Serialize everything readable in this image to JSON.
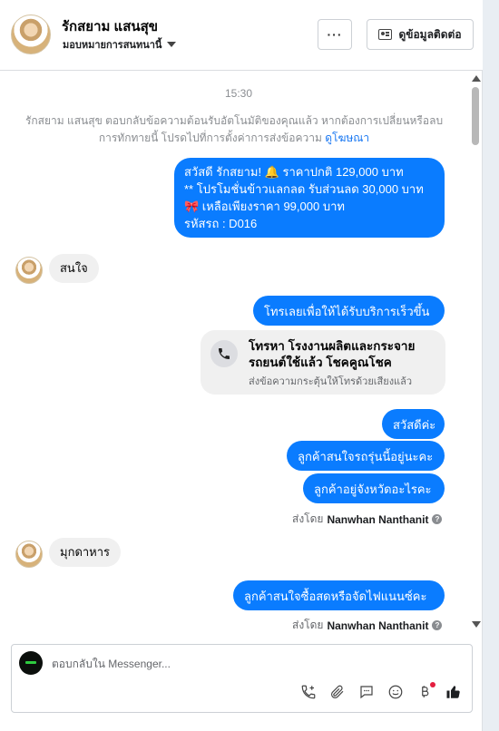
{
  "header": {
    "contact_name": "รักสยาม แสนสุข",
    "assign_label": "มอบหมายการสนทนานี้",
    "more_label": "···",
    "view_contact_label": "ดูข้อมูลติดต่อ"
  },
  "chat": {
    "timestamp": "15:30",
    "system_message": "รักสยาม แสนสุข ตอบกลับข้อความต้อนรับอัตโนมัติของคุณแล้ว หากต้องการเปลี่ยนหรือลบการทักทายนี้ โปรดไปที่การตั้งค่าการส่งข้อความ",
    "system_link": "ดูโฆษณา",
    "promo_lines": [
      "สวัสดี รักสยาม! 🔔 ราคาปกติ 129,000 บาท",
      "** โปรโมชั่นข้าวแลกลด รับส่วนลด 30,000 บาท",
      "🎀  เหลือเพียงราคา 99,000 บาท",
      " รหัสรถ : D016"
    ],
    "customer_msg_1": "สนใจ",
    "out_call_prompt": "โทรเลยเพื่อให้ได้รับบริการเร็วขึ้น",
    "call_card": {
      "title": "โทรหา โรงงานผลิตและกระจายรถยนต์ใช้แล้ว โชคคูณโชค",
      "subtitle": "ส่งข้อความกระตุ้นให้โทรด้วยเสียงแล้ว",
      "icon": "phone-icon"
    },
    "out_hello": "สวัสดีค่ะ",
    "out_model": "ลูกค้าสนใจรถรุ่นนี้อยู่นะคะ",
    "out_province": "ลูกค้าอยู่จังหวัดอะไรคะ",
    "sent_by_label": "ส่งโดย",
    "sent_by_name": "Nanwhan Nanthanit",
    "customer_msg_2": "มุกดาหาร",
    "out_cash": "ลูกค้าสนใจซื้อสดหรือจัดไฟแนนซ์คะ",
    "info_glyph": "?"
  },
  "composer": {
    "placeholder": "ตอบกลับใน Messenger...",
    "tools": [
      "call-add-icon",
      "attachment-icon",
      "saved-reply-icon",
      "emoji-icon",
      "payment-icon",
      "like-icon"
    ]
  },
  "colors": {
    "outgoing_bubble": "#0a7cff",
    "incoming_bubble": "#f0f0f0",
    "link": "#1877f2"
  }
}
